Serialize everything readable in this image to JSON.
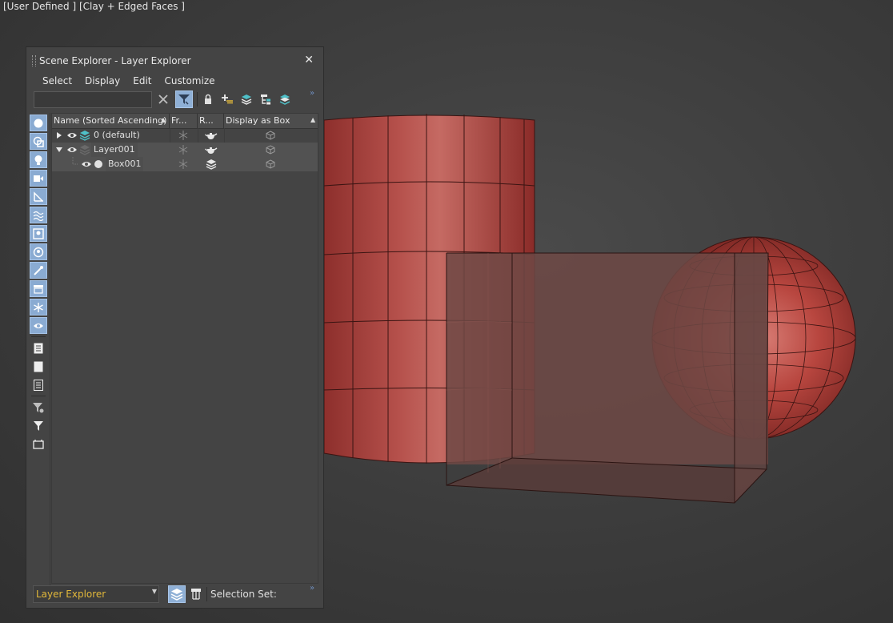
{
  "viewport": {
    "label": "[User Defined ] [Clay + Edged Faces ]",
    "mesh_color": "#b0433f",
    "wire_color": "#3a1412"
  },
  "panel": {
    "title": "Scene Explorer - Layer Explorer",
    "close_glyph": "✕",
    "menu": [
      "Select",
      "Display",
      "Edit",
      "Customize"
    ],
    "search": {
      "value": "",
      "placeholder": ""
    },
    "toolbar_icons": [
      "clear-search-icon",
      "filter-toggle-icon",
      "lock-icon",
      "new-layer-icon",
      "layers-icon",
      "hierarchy-icon",
      "layer-stack-icon"
    ],
    "expand_glyph": "»",
    "columns": [
      "Name (Sorted Ascending)",
      "Fr...",
      "R...",
      "Display as Box"
    ],
    "rows": [
      {
        "name": "0 (default)",
        "level": 0,
        "expanded": false,
        "type": "layer-active"
      },
      {
        "name": "Layer001",
        "level": 0,
        "expanded": true,
        "type": "layer"
      },
      {
        "name": "Box001",
        "level": 1,
        "expanded": false,
        "type": "object"
      }
    ],
    "sidebar_icons": [
      "geometry-icon",
      "shapes-icon",
      "lights-icon",
      "cameras-icon",
      "helpers-icon",
      "spacewarps-icon",
      "groups-icon",
      "xrefs-icon",
      "bones-icon",
      "containers-icon",
      "frozen-icon",
      "hidden-icon",
      "list-all-icon",
      "list-none-icon",
      "invert-list-icon",
      "filter-settings-icon",
      "filter-icon",
      "containers-toggle-icon"
    ],
    "bottom": {
      "explorer_value": "Layer Explorer",
      "selection_set_label": "Selection Set:"
    },
    "accent": "#8fb0d6",
    "highlight_text": "#e2b83a"
  }
}
